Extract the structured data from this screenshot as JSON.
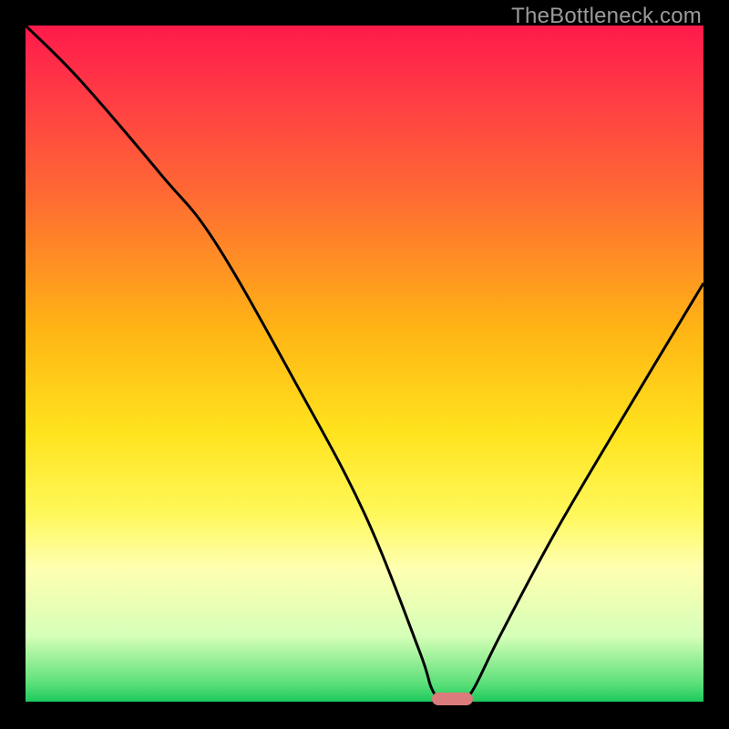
{
  "watermark": "TheBottleneck.com",
  "chart_data": {
    "type": "line",
    "title": "",
    "xlabel": "",
    "ylabel": "",
    "xlim": [
      0,
      100
    ],
    "ylim": [
      0,
      100
    ],
    "x": [
      0,
      8,
      20,
      28,
      40,
      50,
      58,
      60,
      62,
      64,
      66,
      70,
      78,
      88,
      100
    ],
    "values": [
      100,
      92,
      78,
      68,
      47,
      28,
      8,
      2,
      0,
      0,
      2,
      10,
      25,
      42,
      62
    ],
    "optimum_x": 63,
    "optimum_width": 6,
    "gradient_stops": [
      {
        "pct": 0,
        "color": "#ff1a4b"
      },
      {
        "pct": 10,
        "color": "#ff3a45"
      },
      {
        "pct": 25,
        "color": "#ff6a33"
      },
      {
        "pct": 45,
        "color": "#ffb514"
      },
      {
        "pct": 60,
        "color": "#ffe31e"
      },
      {
        "pct": 72,
        "color": "#fff85a"
      },
      {
        "pct": 80,
        "color": "#ffffb0"
      },
      {
        "pct": 90,
        "color": "#d6ffb8"
      },
      {
        "pct": 97,
        "color": "#5de07a"
      },
      {
        "pct": 100,
        "color": "#16c75a"
      }
    ],
    "marker_color": "#db7b7b"
  }
}
